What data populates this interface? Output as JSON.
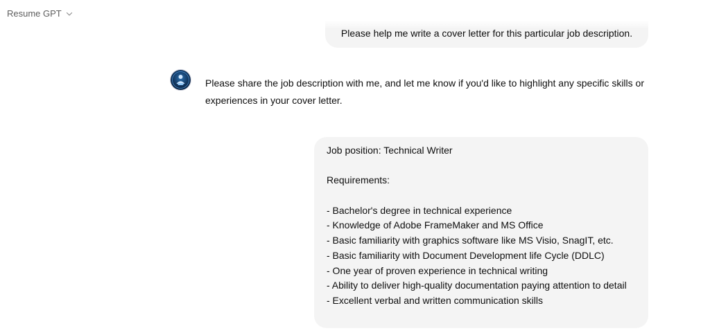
{
  "header": {
    "model_name": "Resume GPT"
  },
  "conversation": {
    "user_message_1": "Please help me write a cover letter for this particular job description.",
    "assistant_message": "Please share the job description with me, and let me know if you'd like to highlight any specific skills or experiences in your cover letter.",
    "user_message_2": {
      "position_line": "Job position: Technical Writer",
      "requirements_heading": "Requirements:",
      "requirements": [
        "- Bachelor's degree in technical experience",
        "- Knowledge of Adobe FrameMaker and MS Office",
        "- Basic familiarity with graphics software like MS Visio, SnagIT, etc.",
        "- Basic familiarity with Document Development life Cycle (DDLC)",
        "- One year of proven experience in technical writing",
        "- Ability to deliver high-quality documentation paying attention to detail",
        "- Excellent verbal and written communication skills"
      ]
    }
  },
  "icons": {
    "model_selector": "chevron-down-icon",
    "assistant_avatar": "gpt-avatar-icon"
  },
  "colors": {
    "user_bubble": "#f4f4f4",
    "text": "#0d0d0d",
    "muted_text": "#5d5d5d",
    "avatar_dark": "#0f2f55"
  }
}
